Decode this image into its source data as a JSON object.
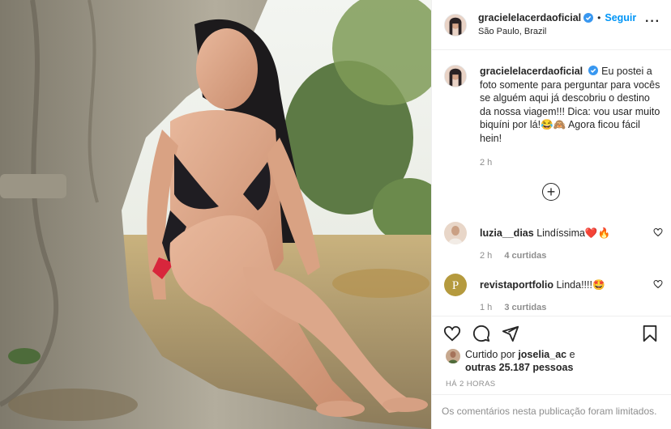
{
  "post": {
    "author": {
      "username": "gracielelacerdaoficial",
      "verified": true,
      "follow_label": "Seguir",
      "separator": "•",
      "location": "São Paulo, Brazil",
      "more_label": "···"
    },
    "caption": {
      "username": "gracielelacerdaoficial",
      "text": "Eu postei a foto somente para perguntar para vocês se alguém aqui já descobriu o destino da nossa viagem!!! Dica: vou usar muito biquíni por lá!😂🙈 Agora ficou fácil hein!",
      "time": "2 h"
    },
    "load_more_label": "+",
    "comments": [
      {
        "username": "luzia__dias",
        "text": "Lindíssima❤️🔥",
        "time": "2 h",
        "likes": "4 curtidas",
        "avatar_color": "#e8d6c8"
      },
      {
        "username": "revistaportfolio",
        "text": "Linda!!!!🤩",
        "time": "1 h",
        "likes": "3 curtidas",
        "avatar_color": "#b59a3e"
      }
    ],
    "actions": {
      "like_icon": "heart-outline-icon",
      "comment_icon": "comment-bubble-icon",
      "share_icon": "paper-plane-icon",
      "save_icon": "bookmark-icon"
    },
    "liked_by": {
      "prefix": "Curtido por",
      "user": "joselia_ac",
      "connector": "e",
      "others": "outras 25.187 pessoas"
    },
    "posted_ago": "HÁ 2 HORAS",
    "comments_limited": "Os comentários nesta publicação foram limitados.",
    "colors": {
      "link_blue": "#0095f6",
      "verified_blue": "#3897f0",
      "muted": "#8e8e8e",
      "border": "#efefef"
    }
  }
}
